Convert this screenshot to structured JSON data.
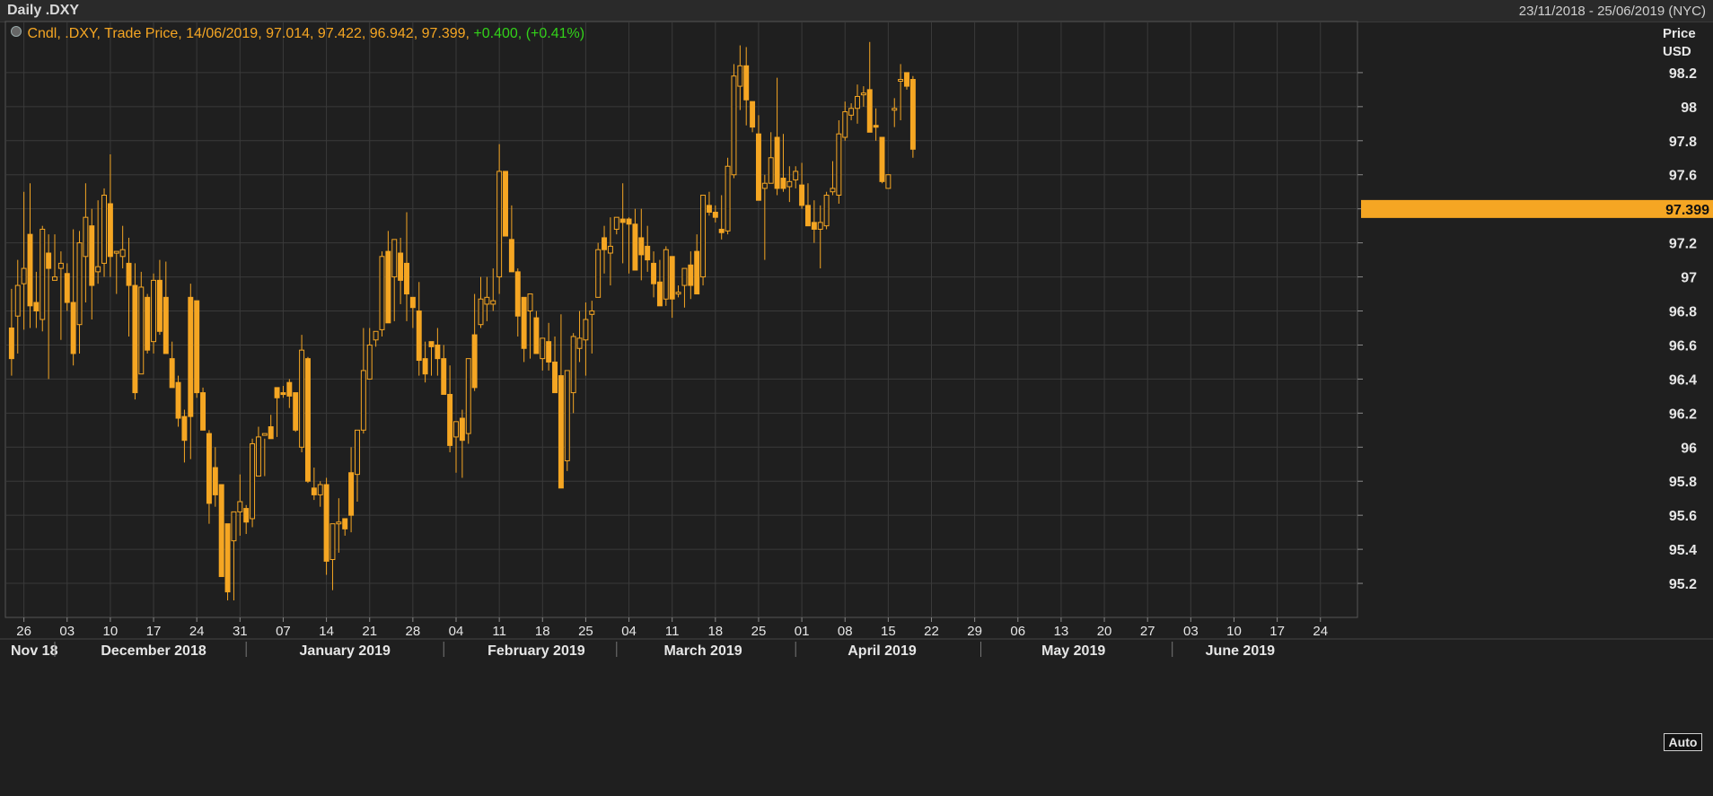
{
  "header": {
    "title": "Daily .DXY",
    "date_range": "23/11/2018 - 25/06/2019 (NYC)"
  },
  "legend": {
    "label": "Cndl, .DXY, Trade Price, 14/06/2019, 97.014, 97.422, 96.942, 97.399,",
    "change": "+0.400, (+0.41%)"
  },
  "axis": {
    "y_title_1": "Price",
    "y_title_2": "USD",
    "auto_label": "Auto"
  },
  "colors": {
    "candle": "#f5a623",
    "background": "#1f1f1f",
    "grid": "#3a3a3a",
    "last_price_bg": "#f5a623",
    "change_text": "#33d11a"
  },
  "chart_data": {
    "type": "candlestick",
    "symbol": ".DXY",
    "ylim": [
      95.0,
      98.5
    ],
    "yticks": [
      95.2,
      95.4,
      95.6,
      95.8,
      96,
      96.2,
      96.4,
      96.6,
      96.8,
      97,
      97.2,
      97.4,
      97.6,
      97.8,
      98,
      98.2
    ],
    "last_price": 97.399,
    "xlim": [
      0,
      219
    ],
    "x_ticks": [
      {
        "label": "26",
        "x": 3
      },
      {
        "label": "03",
        "x": 10
      },
      {
        "label": "10",
        "x": 17
      },
      {
        "label": "17",
        "x": 24
      },
      {
        "label": "24",
        "x": 31
      },
      {
        "label": "31",
        "x": 38
      },
      {
        "label": "07",
        "x": 45
      },
      {
        "label": "14",
        "x": 52
      },
      {
        "label": "21",
        "x": 59
      },
      {
        "label": "28",
        "x": 66
      },
      {
        "label": "04",
        "x": 73
      },
      {
        "label": "11",
        "x": 80
      },
      {
        "label": "18",
        "x": 87
      },
      {
        "label": "25",
        "x": 94
      },
      {
        "label": "04",
        "x": 101
      },
      {
        "label": "11",
        "x": 108
      },
      {
        "label": "18",
        "x": 115
      },
      {
        "label": "25",
        "x": 122
      },
      {
        "label": "01",
        "x": 129
      },
      {
        "label": "08",
        "x": 136
      },
      {
        "label": "15",
        "x": 143
      },
      {
        "label": "22",
        "x": 150
      },
      {
        "label": "29",
        "x": 157
      },
      {
        "label": "06",
        "x": 164
      },
      {
        "label": "13",
        "x": 171
      },
      {
        "label": "20",
        "x": 178
      },
      {
        "label": "27",
        "x": 185
      },
      {
        "label": "03",
        "x": 192
      },
      {
        "label": "10",
        "x": 199
      },
      {
        "label": "17",
        "x": 206
      },
      {
        "label": "24",
        "x": 213
      }
    ],
    "months": [
      {
        "label": "Nov 18",
        "x": 5,
        "sep": 8
      },
      {
        "label": "December 2018",
        "x": 24,
        "sep": 39
      },
      {
        "label": "January 2019",
        "x": 55,
        "sep": 71
      },
      {
        "label": "February 2019",
        "x": 86,
        "sep": 99
      },
      {
        "label": "March 2019",
        "x": 113,
        "sep": 128
      },
      {
        "label": "April 2019",
        "x": 142,
        "sep": 158
      },
      {
        "label": "May 2019",
        "x": 173,
        "sep": 189
      },
      {
        "label": "June 2019",
        "x": 200,
        "sep": null
      }
    ],
    "candles": [
      [
        1,
        96.7,
        96.93,
        96.42,
        96.52
      ],
      [
        2,
        96.77,
        97.1,
        96.55,
        96.95
      ],
      [
        3,
        96.96,
        97.5,
        96.69,
        97.05
      ],
      [
        4,
        97.25,
        97.55,
        96.7,
        96.83
      ],
      [
        5,
        96.85,
        97.03,
        96.7,
        96.8
      ],
      [
        6,
        96.75,
        97.3,
        96.68,
        97.28
      ],
      [
        7,
        97.14,
        97.25,
        96.4,
        97.05
      ],
      [
        8,
        96.98,
        97.25,
        96.98,
        97.0
      ],
      [
        9,
        97.05,
        97.15,
        96.63,
        97.08
      ],
      [
        10,
        97.02,
        97.08,
        96.8,
        96.85
      ],
      [
        11,
        96.85,
        97.28,
        96.48,
        96.55
      ],
      [
        12,
        96.72,
        97.27,
        96.55,
        97.2
      ],
      [
        13,
        97.12,
        97.55,
        96.85,
        97.35
      ],
      [
        14,
        97.3,
        97.4,
        96.75,
        96.95
      ],
      [
        15,
        97.03,
        97.45,
        96.96,
        97.06
      ],
      [
        16,
        97.08,
        97.52,
        97.0,
        97.48
      ],
      [
        17,
        97.43,
        97.72,
        97.0,
        97.12
      ],
      [
        18,
        97.15,
        97.15,
        96.9,
        97.15
      ],
      [
        19,
        97.12,
        97.3,
        97.05,
        97.16
      ],
      [
        20,
        97.08,
        97.23,
        96.65,
        96.95
      ],
      [
        21,
        96.95,
        97.08,
        96.28,
        96.32
      ],
      [
        22,
        96.43,
        97.03,
        96.45,
        96.94
      ],
      [
        23,
        96.88,
        96.9,
        96.55,
        96.57
      ],
      [
        24,
        96.62,
        97.02,
        96.55,
        96.98
      ],
      [
        25,
        96.98,
        97.1,
        96.66,
        96.68
      ],
      [
        26,
        96.88,
        97.09,
        96.68,
        96.55
      ],
      [
        27,
        96.52,
        96.62,
        96.4,
        96.35
      ],
      [
        28,
        96.38,
        96.42,
        96.12,
        96.17
      ],
      [
        29,
        96.18,
        96.22,
        95.91,
        96.04
      ],
      [
        30,
        96.88,
        96.96,
        95.93,
        96.18
      ],
      [
        31,
        96.86,
        96.81,
        96.29,
        96.32
      ],
      [
        32,
        96.32,
        96.35,
        96.12,
        96.1
      ],
      [
        33,
        96.08,
        96.1,
        95.55,
        95.67
      ],
      [
        34,
        95.88,
        96.0,
        95.65,
        95.72
      ],
      [
        35,
        95.78,
        95.78,
        95.34,
        95.24
      ],
      [
        36,
        95.55,
        95.55,
        95.1,
        95.15
      ],
      [
        37,
        95.45,
        95.55,
        95.1,
        95.62
      ],
      [
        38,
        95.62,
        95.84,
        95.48,
        95.68
      ],
      [
        39,
        95.64,
        95.66,
        95.49,
        95.56
      ],
      [
        40,
        95.58,
        96.05,
        95.53,
        96.02
      ],
      [
        41,
        95.83,
        96.12,
        95.94,
        96.06
      ],
      [
        42,
        96.08,
        96.05,
        95.83,
        96.08
      ],
      [
        43,
        96.12,
        96.19,
        96.08,
        96.05
      ],
      [
        44,
        96.35,
        96.33,
        96.06,
        96.29
      ],
      [
        45,
        96.32,
        96.36,
        96.29,
        96.31
      ],
      [
        46,
        96.38,
        96.4,
        96.23,
        96.3
      ],
      [
        47,
        96.32,
        96.3,
        96.09,
        96.1
      ],
      [
        48,
        96.0,
        96.66,
        95.97,
        96.57
      ],
      [
        49,
        96.52,
        96.53,
        95.79,
        95.8
      ],
      [
        50,
        95.76,
        95.88,
        95.69,
        95.72
      ],
      [
        51,
        95.72,
        95.8,
        95.65,
        95.78
      ],
      [
        52,
        95.78,
        95.82,
        95.25,
        95.33
      ],
      [
        53,
        95.34,
        95.54,
        95.16,
        95.55
      ],
      [
        54,
        95.55,
        95.7,
        95.38,
        95.56
      ],
      [
        55,
        95.58,
        95.58,
        95.48,
        95.52
      ],
      [
        56,
        95.85,
        96.0,
        95.5,
        95.6
      ],
      [
        57,
        95.84,
        96.0,
        95.68,
        96.1
      ],
      [
        58,
        96.1,
        96.7,
        96.08,
        96.45
      ],
      [
        59,
        96.4,
        96.7,
        96.43,
        96.6
      ],
      [
        60,
        96.63,
        96.68,
        96.59,
        96.68
      ],
      [
        61,
        96.69,
        97.15,
        96.65,
        97.12
      ],
      [
        62,
        97.15,
        97.27,
        96.74,
        96.73
      ],
      [
        63,
        97.0,
        97.2,
        96.74,
        97.22
      ],
      [
        64,
        97.14,
        97.23,
        96.84,
        96.98
      ],
      [
        65,
        97.08,
        97.38,
        96.74,
        96.9
      ],
      [
        66,
        96.88,
        96.88,
        96.7,
        96.82
      ],
      [
        67,
        96.8,
        96.97,
        96.42,
        96.51
      ],
      [
        68,
        96.52,
        96.62,
        96.38,
        96.43
      ],
      [
        69,
        96.62,
        96.6,
        96.42,
        96.59
      ],
      [
        70,
        96.6,
        96.7,
        96.42,
        96.52
      ],
      [
        71,
        96.52,
        96.6,
        96.31,
        96.31
      ],
      [
        72,
        96.31,
        96.48,
        95.97,
        96.01
      ],
      [
        73,
        96.06,
        96.15,
        95.85,
        96.15
      ],
      [
        74,
        96.17,
        96.22,
        95.82,
        96.04
      ],
      [
        75,
        96.08,
        96.48,
        96.02,
        96.52
      ],
      [
        76,
        96.66,
        96.9,
        96.33,
        96.35
      ],
      [
        77,
        96.72,
        97.0,
        96.7,
        96.87
      ],
      [
        78,
        96.84,
        97.0,
        96.74,
        96.88
      ],
      [
        79,
        96.84,
        97.05,
        96.8,
        96.86
      ],
      [
        80,
        97.0,
        97.78,
        96.9,
        97.62
      ],
      [
        81,
        97.62,
        97.48,
        97.25,
        97.24
      ],
      [
        82,
        97.22,
        97.42,
        97.08,
        97.03
      ],
      [
        83,
        97.03,
        97.05,
        96.65,
        96.77
      ],
      [
        84,
        96.88,
        96.87,
        96.5,
        96.58
      ],
      [
        85,
        96.8,
        96.87,
        96.52,
        96.9
      ],
      [
        86,
        96.76,
        96.8,
        96.56,
        96.55
      ],
      [
        87,
        96.52,
        96.62,
        96.45,
        96.64
      ],
      [
        88,
        96.62,
        96.73,
        96.45,
        96.5
      ],
      [
        89,
        96.5,
        96.65,
        96.42,
        96.32
      ],
      [
        90,
        96.42,
        96.78,
        95.78,
        95.76
      ],
      [
        91,
        95.92,
        96.1,
        95.86,
        96.45
      ],
      [
        92,
        96.32,
        96.67,
        96.2,
        96.65
      ],
      [
        93,
        96.58,
        96.8,
        96.5,
        96.64
      ],
      [
        94,
        96.63,
        96.85,
        96.42,
        96.75
      ],
      [
        95,
        96.78,
        96.86,
        96.55,
        96.8
      ],
      [
        96,
        96.88,
        97.2,
        96.93,
        97.16
      ],
      [
        97,
        97.23,
        97.3,
        97.02,
        97.16
      ],
      [
        98,
        97.14,
        97.35,
        96.95,
        97.18
      ],
      [
        99,
        97.28,
        97.28,
        97.25,
        97.35
      ],
      [
        100,
        97.34,
        97.55,
        97.08,
        97.32
      ],
      [
        101,
        97.34,
        97.35,
        97.02,
        97.31
      ],
      [
        102,
        97.31,
        97.4,
        97.05,
        97.04
      ],
      [
        103,
        97.23,
        97.4,
        96.98,
        97.13
      ],
      [
        104,
        97.18,
        97.3,
        97.03,
        97.1
      ],
      [
        105,
        97.08,
        97.15,
        96.88,
        96.96
      ],
      [
        106,
        96.97,
        97.1,
        96.85,
        96.83
      ],
      [
        107,
        96.87,
        97.18,
        96.83,
        97.16
      ],
      [
        108,
        97.12,
        97.12,
        96.76,
        96.87
      ],
      [
        109,
        96.91,
        96.95,
        96.88,
        96.91
      ],
      [
        110,
        96.95,
        97.05,
        96.82,
        97.05
      ],
      [
        111,
        97.07,
        97.15,
        96.87,
        96.95
      ],
      [
        112,
        97.15,
        97.25,
        97.0,
        96.9
      ],
      [
        113,
        97.0,
        97.48,
        96.95,
        97.48
      ],
      [
        114,
        97.42,
        97.5,
        97.36,
        97.38
      ],
      [
        115,
        97.38,
        97.42,
        97.32,
        97.35
      ],
      [
        116,
        97.28,
        97.48,
        97.22,
        97.26
      ],
      [
        117,
        97.27,
        97.7,
        97.25,
        97.65
      ],
      [
        118,
        97.6,
        98.25,
        97.58,
        98.18
      ],
      [
        119,
        98.12,
        98.36,
        97.98,
        98.24
      ],
      [
        120,
        98.24,
        98.35,
        97.89,
        98.04
      ],
      [
        121,
        98.03,
        98.03,
        97.85,
        97.88
      ],
      [
        122,
        97.84,
        97.95,
        97.45,
        97.45
      ],
      [
        123,
        97.52,
        97.6,
        97.1,
        97.55
      ],
      [
        124,
        97.55,
        97.85,
        97.55,
        97.7
      ],
      [
        125,
        97.82,
        98.17,
        97.48,
        97.52
      ],
      [
        126,
        97.58,
        97.84,
        97.5,
        97.52
      ],
      [
        127,
        97.53,
        97.65,
        97.44,
        97.56
      ],
      [
        128,
        97.57,
        97.65,
        97.52,
        97.62
      ],
      [
        129,
        97.54,
        97.67,
        97.4,
        97.42
      ],
      [
        130,
        97.42,
        97.55,
        97.3,
        97.3
      ],
      [
        131,
        97.32,
        97.45,
        97.2,
        97.28
      ],
      [
        132,
        97.28,
        97.42,
        97.05,
        97.32
      ],
      [
        133,
        97.3,
        97.5,
        97.28,
        97.48
      ],
      [
        134,
        97.5,
        97.68,
        97.48,
        97.52
      ],
      [
        135,
        97.48,
        97.92,
        97.43,
        97.84
      ],
      [
        136,
        97.82,
        98.03,
        97.8,
        97.97
      ],
      [
        137,
        97.95,
        98.02,
        97.92,
        97.99
      ],
      [
        138,
        97.99,
        98.13,
        97.9,
        98.06
      ],
      [
        139,
        98.08,
        98.12,
        98.0,
        98.08
      ],
      [
        140,
        98.1,
        98.38,
        97.86,
        97.85
      ],
      [
        141,
        97.89,
        97.99,
        97.8,
        97.88
      ],
      [
        142,
        97.82,
        97.82,
        97.55,
        97.56
      ],
      [
        143,
        97.52,
        97.6,
        97.52,
        97.6
      ],
      [
        144,
        97.98,
        98.05,
        97.88,
        97.99
      ],
      [
        145,
        98.16,
        98.25,
        97.92,
        98.16
      ],
      [
        146,
        98.2,
        98.2,
        98.1,
        98.12
      ],
      [
        147,
        98.16,
        98.18,
        97.7,
        97.75
      ]
    ]
  }
}
